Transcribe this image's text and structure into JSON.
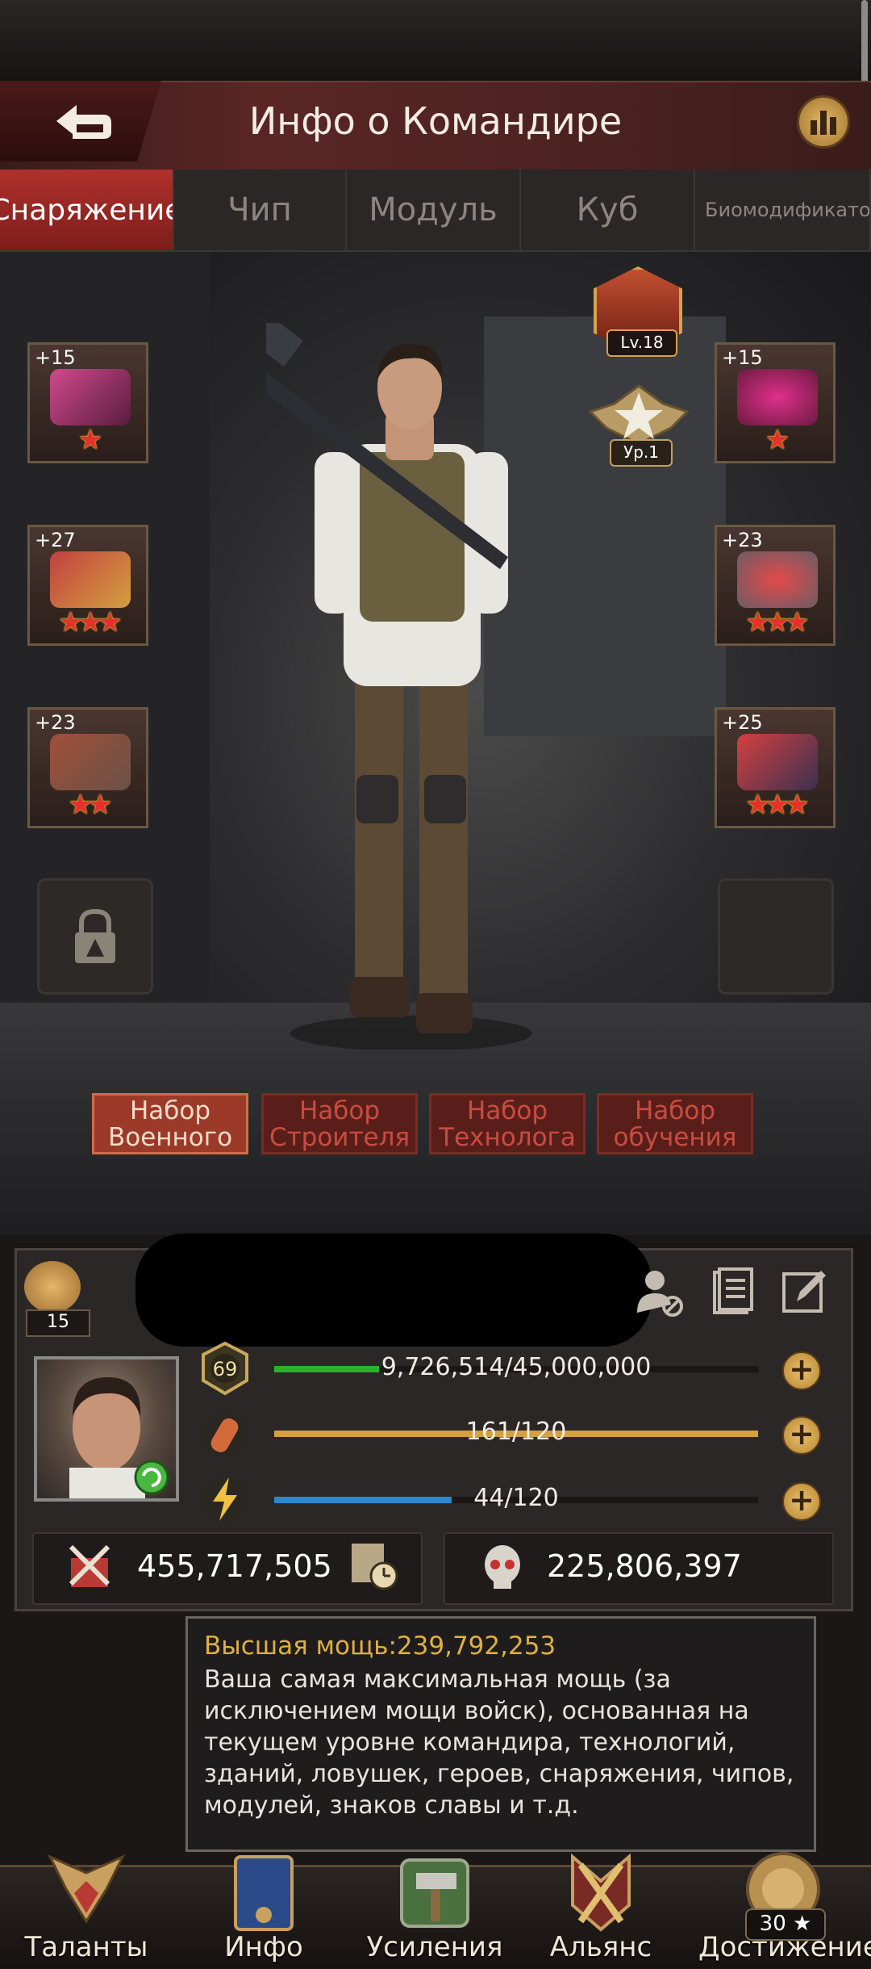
{
  "header": {
    "title": "Инфо о Командире"
  },
  "tabs": [
    {
      "label": "Снаряжение",
      "active": true
    },
    {
      "label": "Чип"
    },
    {
      "label": "Модуль"
    },
    {
      "label": "Куб"
    },
    {
      "label": "Биомодификатор"
    }
  ],
  "badges": {
    "level": "Lv.18",
    "rank": "Ур.1"
  },
  "equipment": {
    "left": [
      {
        "level": "+15",
        "stars": "★",
        "icon": "pink-rifle-icon"
      },
      {
        "level": "+27",
        "stars": "★★★",
        "icon": "armor-vest-icon"
      },
      {
        "level": "+23",
        "stars": "★★",
        "icon": "power-armor-icon"
      }
    ],
    "right": [
      {
        "level": "+15",
        "stars": "★",
        "icon": "helmet-icon"
      },
      {
        "level": "+23",
        "stars": "★★★",
        "icon": "ring-gem-icon"
      },
      {
        "level": "+25",
        "stars": "★★★",
        "icon": "boots-icon"
      }
    ]
  },
  "sets": [
    {
      "line1": "Набор",
      "line2": "Военного",
      "active": true
    },
    {
      "line1": "Набор",
      "line2": "Строителя"
    },
    {
      "line1": "Набор",
      "line2": "Технолога"
    },
    {
      "line1": "Набор",
      "line2": "обучения"
    }
  ],
  "profile": {
    "likes": "15",
    "commander_level": "69",
    "exp": "9,726,514/45,000,000",
    "exp_fraction": 0.216,
    "stamina": "161/120",
    "stamina_fraction": 1.0,
    "energy": "44/120",
    "energy_fraction": 0.367,
    "power": "455,717,505",
    "kills": "225,806,397"
  },
  "tooltip": {
    "title": "Высшая мощь:239,792,253",
    "body": "Ваша самая максимальная мощь (за исключением мощи войск), основанная на текущем уровне командира, технологий, зданий, ловушек, героев, снаряжения, чипов, модулей, знаков славы и т.д."
  },
  "nav": [
    {
      "label": "Таланты",
      "icon": "talents-wings-icon"
    },
    {
      "label": "Инфо",
      "icon": "info-book-icon"
    },
    {
      "label": "Усиления",
      "icon": "boosts-hammer-icon"
    },
    {
      "label": "Альянс",
      "icon": "alliance-swords-icon"
    },
    {
      "label": "Достижение",
      "icon": "achievement-lion-icon",
      "count": "30 ★"
    }
  ],
  "colors": {
    "accent_red": "#b0312c",
    "exp_bar": "#2db030",
    "stamina_bar": "#d4a040",
    "energy_bar": "#2a88d0",
    "gold": "#e0b040"
  }
}
